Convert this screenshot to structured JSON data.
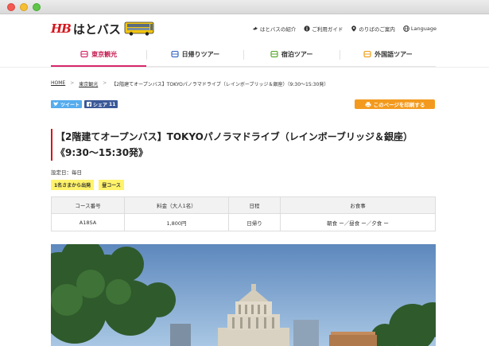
{
  "window": {
    "controls": [
      "close",
      "minimize",
      "zoom"
    ]
  },
  "header": {
    "logo_mark": "HB",
    "logo_text": "はとバス",
    "utility_links": [
      {
        "icon": "bird-icon",
        "label": "はとバスの紹介"
      },
      {
        "icon": "info-icon",
        "label": "ご利用ガイド"
      },
      {
        "icon": "pin-icon",
        "label": "のりばのご案内"
      },
      {
        "icon": "globe-icon",
        "label": "Language"
      }
    ]
  },
  "nav": {
    "items": [
      {
        "label": "東京観光",
        "color": "#d6286b",
        "active": true
      },
      {
        "label": "日帰りツアー",
        "color": "#3d6cc4",
        "active": false
      },
      {
        "label": "宿泊ツアー",
        "color": "#5aaa2e",
        "active": false
      },
      {
        "label": "外国語ツアー",
        "color": "#f0a020",
        "active": false
      }
    ]
  },
  "breadcrumb": {
    "home": "HOME",
    "sep": ">",
    "parent": "東京観光",
    "current": "【2階建てオープンバス】TOKYOパノラマドライブ（レインボーブリッジ＆銀座）（9:30～15:30発）"
  },
  "share": {
    "tweet": "ツイート",
    "facebook": "シェア",
    "facebook_count": "11"
  },
  "print_label": "このページを印刷する",
  "title_line1": "【2階建てオープンバス】TOKYOパノラマドライブ（レインボーブリッジ＆銀座）",
  "title_line2": "《9:30～15:30発》",
  "setday": "設定日：毎日",
  "tags": [
    "1名さまから出発",
    "昼コース"
  ],
  "table": {
    "headers": [
      "コース番号",
      "料金（大人1名）",
      "日程",
      "お食事"
    ],
    "row": {
      "code": "A18SA",
      "price": "1,800円",
      "schedule": "日帰り",
      "meal": "朝食 ー／昼食 ー／夕食 ー"
    }
  },
  "colors": {
    "brand_red": "#d4151c",
    "print_orange": "#f39a1e",
    "tag_yellow": "#fff36b"
  }
}
